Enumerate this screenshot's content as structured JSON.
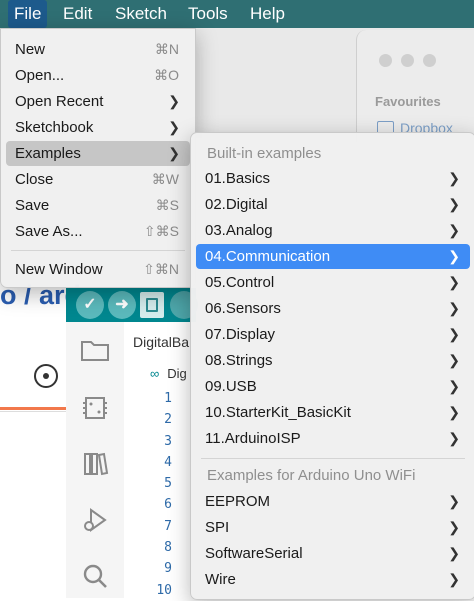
{
  "menubar": {
    "items": [
      "File",
      "Edit",
      "Sketch",
      "Tools",
      "Help"
    ]
  },
  "finder": {
    "favourites_label": "Favourites",
    "dropbox_label": "Dropbox"
  },
  "background": {
    "breadcrumb": "o / ard"
  },
  "ide": {
    "tab_name": "DigitalBa",
    "code_line1_prefix": "∞",
    "code_line1": "Dig",
    "line_numbers": [
      "1",
      "2",
      "3",
      "4",
      "5",
      "6",
      "7",
      "8",
      "9",
      "10"
    ]
  },
  "file_menu": {
    "new": {
      "label": "New",
      "shortcut": "⌘N"
    },
    "open": {
      "label": "Open...",
      "shortcut": "⌘O"
    },
    "open_recent": {
      "label": "Open Recent"
    },
    "sketchbook": {
      "label": "Sketchbook"
    },
    "examples": {
      "label": "Examples"
    },
    "close": {
      "label": "Close",
      "shortcut": "⌘W"
    },
    "save": {
      "label": "Save",
      "shortcut": "⌘S"
    },
    "save_as": {
      "label": "Save As...",
      "shortcut": "⇧⌘S"
    },
    "new_window": {
      "label": "New Window",
      "shortcut": "⇧⌘N"
    }
  },
  "examples_menu": {
    "builtin_header": "Built-in examples",
    "builtin": [
      "01.Basics",
      "02.Digital",
      "03.Analog",
      "04.Communication",
      "05.Control",
      "06.Sensors",
      "07.Display",
      "08.Strings",
      "09.USB",
      "10.StarterKit_BasicKit",
      "11.ArduinoISP"
    ],
    "selected": "04.Communication",
    "board_header": "Examples for Arduino Uno WiFi",
    "board": [
      "EEPROM",
      "SPI",
      "SoftwareSerial",
      "Wire"
    ]
  },
  "colors": {
    "menubar_bg": "#2f6f73",
    "selection_blue": "#3f8cf5",
    "ide_teal": "#00878f"
  }
}
